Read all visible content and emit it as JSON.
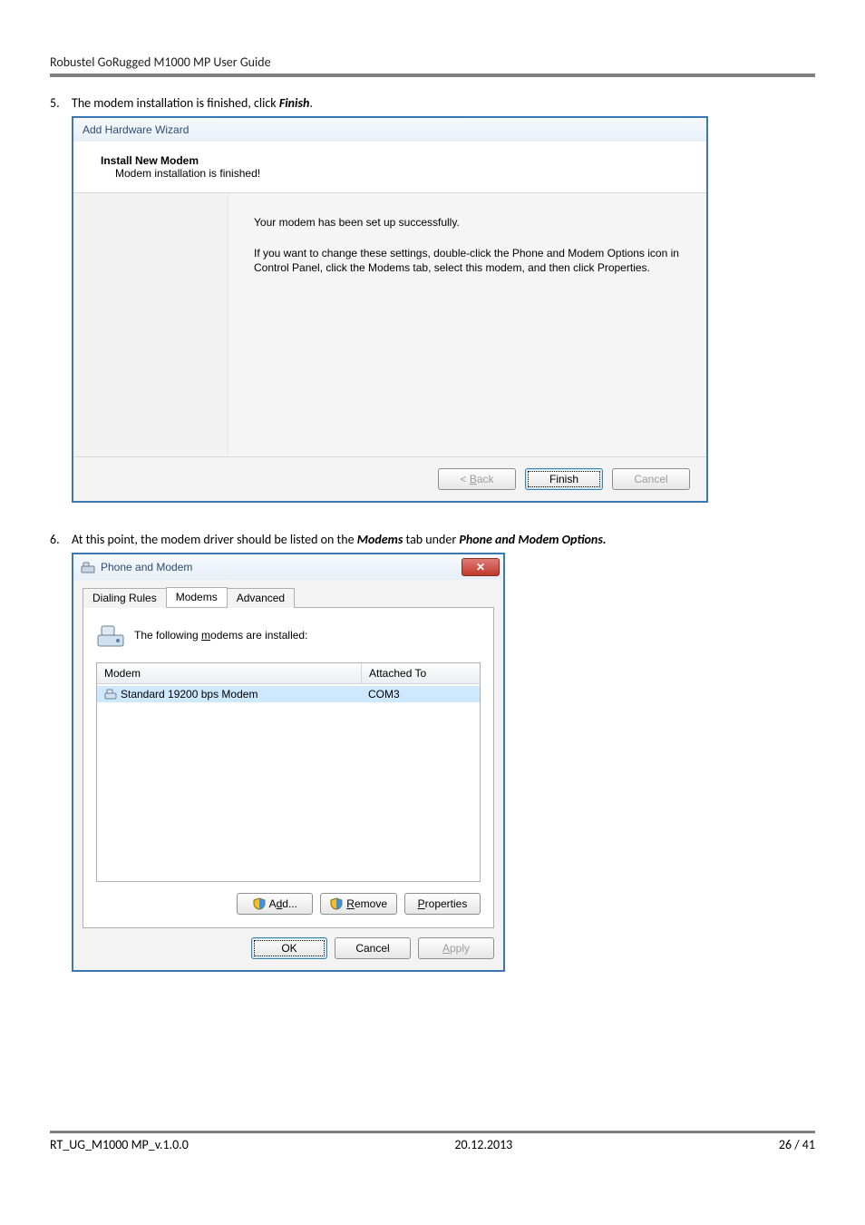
{
  "header": {
    "title": "Robustel GoRugged M1000 MP User Guide"
  },
  "step5": {
    "num": "5.",
    "text_pre": "The modem installation is finished, click ",
    "text_bold": "Finish",
    "text_post": "."
  },
  "wizard": {
    "window_title": "Add Hardware Wizard",
    "header_title": "Install New Modem",
    "header_sub": "Modem installation is finished!",
    "body_line1": "Your modem has been set up successfully.",
    "body_line2": "If you want to change these settings, double-click the Phone and Modem Options icon in Control Panel, click the Modems tab, select this modem, and then click Properties.",
    "btn_back": "< Back",
    "btn_finish": "Finish",
    "btn_cancel": "Cancel"
  },
  "step6": {
    "num": "6.",
    "text_pre": "At this point, the modem driver should be listed on the ",
    "text_b1": "Modems",
    "text_mid": " tab under ",
    "text_b2": "Phone and Modem Options.",
    "text_post": ""
  },
  "pm_dialog": {
    "title": "Phone and Modem",
    "tabs": {
      "dialing": "Dialing Rules",
      "modems": "Modems",
      "advanced": "Advanced"
    },
    "info_text": "The following modems are installed:",
    "col_modem": "Modem",
    "col_attached": "Attached To",
    "row_modem": "Standard 19200 bps Modem",
    "row_port": "COM3",
    "btn_add": "Add...",
    "btn_remove": "Remove",
    "btn_properties": "Properties",
    "btn_ok": "OK",
    "btn_cancel": "Cancel",
    "btn_apply": "Apply"
  },
  "footer": {
    "left": "RT_UG_M1000 MP_v.1.0.0",
    "center": "20.12.2013",
    "right": "26 / 41"
  }
}
